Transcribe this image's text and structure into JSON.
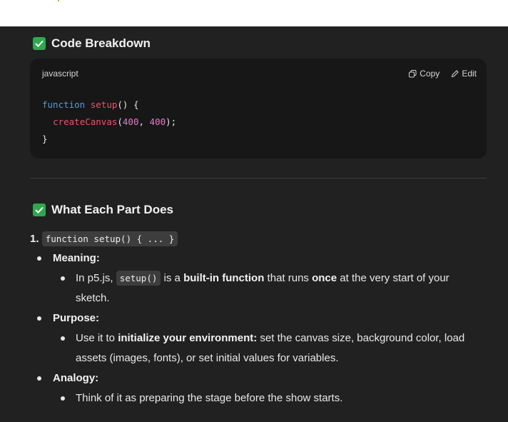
{
  "section1": {
    "title": "Code Breakdown"
  },
  "codeblock": {
    "language": "javascript",
    "copy_label": "Copy",
    "edit_label": "Edit",
    "code": {
      "kw_function": "function",
      "fn_setup": "setup",
      "sig_rest": "() {",
      "fn_create": "createCanvas",
      "paren_open": "(",
      "num_w": "400",
      "comma": ", ",
      "num_h": "400",
      "paren_close": ");",
      "close_brace": "}"
    }
  },
  "section2": {
    "title": "What Each Part Does"
  },
  "list": {
    "item1_number": "1.",
    "item1_code": "function setup() { ... }",
    "meaning_label": "Meaning:",
    "meaning_t1": "In p5.js, ",
    "meaning_code": "setup()",
    "meaning_t2": " is a ",
    "meaning_b1": "built-in function",
    "meaning_t3": " that runs ",
    "meaning_b2": "once",
    "meaning_t4": " at the very start of your",
    "meaning_t5": "sketch.",
    "purpose_label": "Purpose:",
    "purpose_t1": "Use it to ",
    "purpose_b1": "initialize your environment:",
    "purpose_t2": " set the canvas size, background color, load",
    "purpose_t3": "assets (images, fonts), or set initial values for variables.",
    "analogy_label": "Analogy:",
    "analogy_t1": "Think of it as preparing the stage before the show starts."
  },
  "icons": {
    "check": "check-icon",
    "copy": "copy-icon",
    "edit": "edit-icon"
  },
  "colors": {
    "background": "#212121",
    "code_background": "#171717",
    "check_green": "#2fa84f",
    "keyword": "#569cd6",
    "function": "#f0506e",
    "number": "#e879c9"
  }
}
